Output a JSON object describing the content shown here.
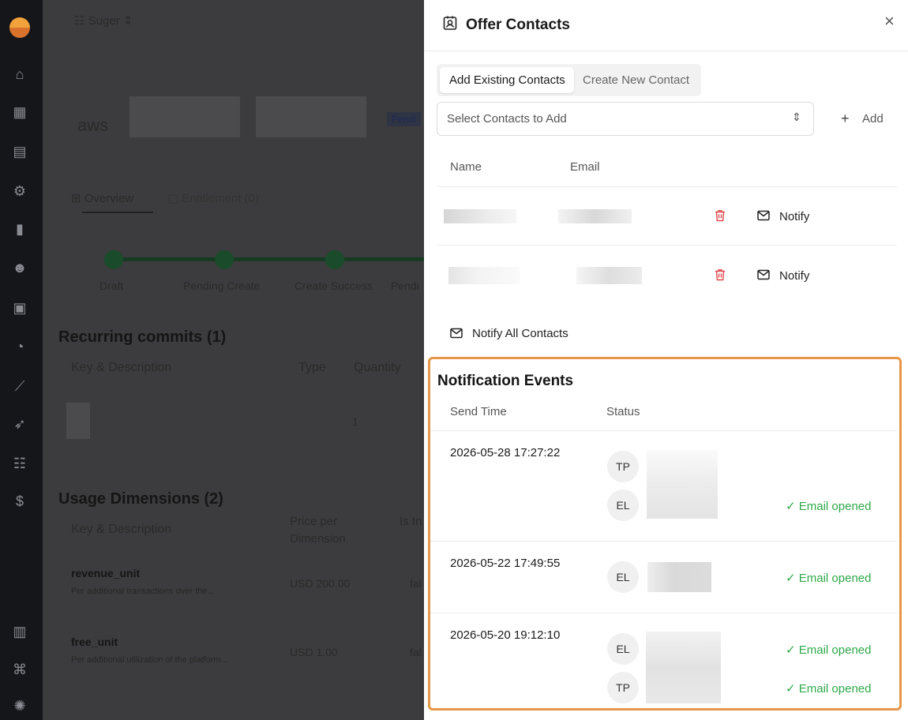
{
  "background_page": {
    "org": "Suger",
    "vendor_logo": "aws",
    "status_badge": "Pendi",
    "tabs": [
      "Overview",
      "Entitlement (0)"
    ],
    "steps": [
      "Draft",
      "Pending Create",
      "Create Success",
      "Pendi"
    ],
    "recurring": {
      "title": "Recurring commits (1)",
      "headers": [
        "Key & Description",
        "Type",
        "Quantity"
      ],
      "quantity": "1"
    },
    "usage": {
      "title": "Usage Dimensions (2)",
      "headers": [
        "Key & Description",
        "Price per Dimension",
        "Is In"
      ],
      "rows": [
        {
          "key": "revenue_unit",
          "desc": "Per additional transactions over the...",
          "price": "USD 200.00",
          "flag": "fal"
        },
        {
          "key": "free_unit",
          "desc": "Per additional utilization of the platform...",
          "price": "USD 1.00",
          "flag": "fal"
        }
      ]
    }
  },
  "drawer": {
    "title": "Offer Contacts",
    "close": "×",
    "tabs": {
      "existing": "Add Existing Contacts",
      "new": "Create New Contact"
    },
    "select_placeholder": "Select Contacts to Add",
    "add_label": "Add",
    "columns": {
      "name": "Name",
      "email": "Email"
    },
    "notify_label": "Notify",
    "notify_all": "Notify All Contacts",
    "events": {
      "title": "Notification Events",
      "columns": {
        "time": "Send Time",
        "status": "Status"
      },
      "rows": [
        {
          "time": "2026-05-28 17:27:22",
          "entries": [
            {
              "initials": "TP",
              "status": ""
            },
            {
              "initials": "EL",
              "status": "Email opened"
            }
          ]
        },
        {
          "time": "2026-05-22 17:49:55",
          "entries": [
            {
              "initials": "EL",
              "status": "Email opened"
            }
          ]
        },
        {
          "time": "2026-05-20 19:12:10",
          "entries": [
            {
              "initials": "EL",
              "status": "Email opened"
            },
            {
              "initials": "TP",
              "status": "Email opened"
            }
          ]
        }
      ]
    }
  },
  "colors": {
    "accent_green": "#2ea84a",
    "highlight": "#e69648",
    "danger": "#e0484e"
  }
}
